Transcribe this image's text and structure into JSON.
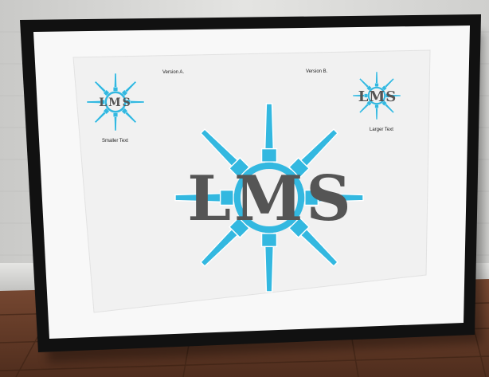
{
  "poster": {
    "version_a_label": "Version A.",
    "version_b_label": "Version B.",
    "smaller_text_caption": "Smaller Text",
    "larger_text_caption": "Larger Text",
    "logo_text_small_a": "LMS",
    "logo_text_small_b": "LMS",
    "logo_text_large": "LMS"
  },
  "colors": {
    "wall": "#dcdcda",
    "frame": "#101010",
    "mat": "#f7f7f7",
    "artwork": "#f2f2f2",
    "accent_cyan": "#33b8e0",
    "logo_grey": "#555555",
    "floor": "#6b3f2a"
  }
}
